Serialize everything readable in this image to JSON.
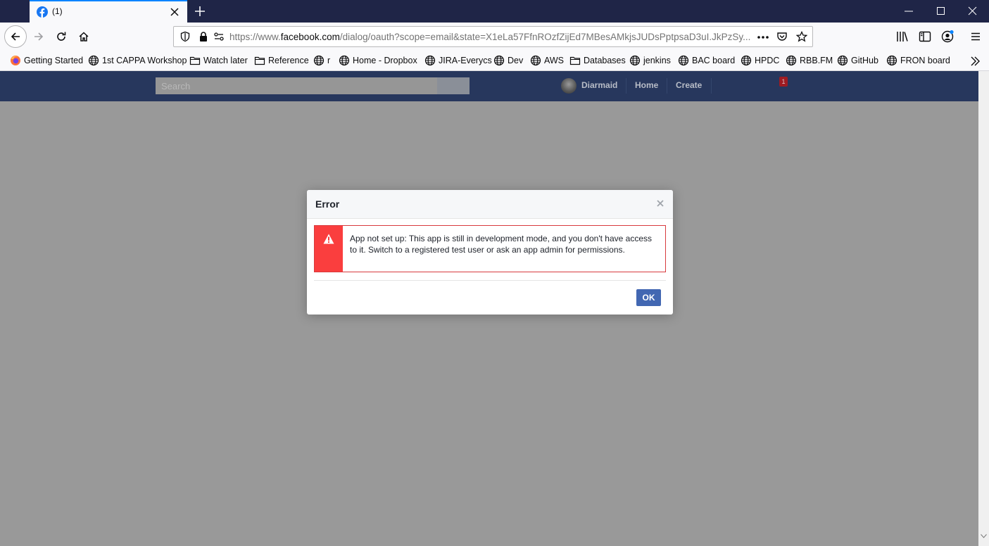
{
  "browser": {
    "tab": {
      "title": "(1)",
      "favicon": "facebook-icon"
    },
    "url": {
      "prefix": "https://www.",
      "domain": "facebook.com",
      "rest": "/dialog/oauth?scope=email&state=X1eLa57FfnROzfZijEd7MBesAMkjsJUDsPptpsaD3uI.JkPzSy..."
    },
    "bookmarks": [
      {
        "label": "Getting Started",
        "icon": "firefox-icon"
      },
      {
        "label": "1st CAPPA Workshop",
        "icon": "globe-icon"
      },
      {
        "label": "Watch later",
        "icon": "folder-icon"
      },
      {
        "label": "Reference",
        "icon": "folder-icon"
      },
      {
        "label": "r",
        "icon": "globe-icon"
      },
      {
        "label": "Home - Dropbox",
        "icon": "globe-icon"
      },
      {
        "label": "JIRA-Everycs",
        "icon": "globe-icon"
      },
      {
        "label": "Dev",
        "icon": "globe-icon"
      },
      {
        "label": "AWS",
        "icon": "globe-icon"
      },
      {
        "label": "Databases",
        "icon": "folder-icon"
      },
      {
        "label": "jenkins",
        "icon": "globe-icon"
      },
      {
        "label": "BAC board",
        "icon": "globe-icon"
      },
      {
        "label": "HPDC",
        "icon": "globe-icon"
      },
      {
        "label": "RBB.FM",
        "icon": "globe-icon"
      },
      {
        "label": "GitHub",
        "icon": "globe-icon"
      },
      {
        "label": "FRON board",
        "icon": "globe-icon"
      }
    ]
  },
  "fb_header": {
    "search_placeholder": "Search",
    "user_name": "Diarmaid",
    "home": "Home",
    "create": "Create",
    "notification_count": "1"
  },
  "dialog": {
    "title": "Error",
    "message": "App not set up: This app is still in development mode, and you don't have access to it. Switch to a registered test user or ask an app admin for permissions.",
    "ok_label": "OK"
  },
  "colors": {
    "fb_header": "#27375d",
    "overlay": "#999999",
    "error_red": "#fa3e3e",
    "ok_button": "#4267b2",
    "tabstrip": "#1f2547"
  }
}
